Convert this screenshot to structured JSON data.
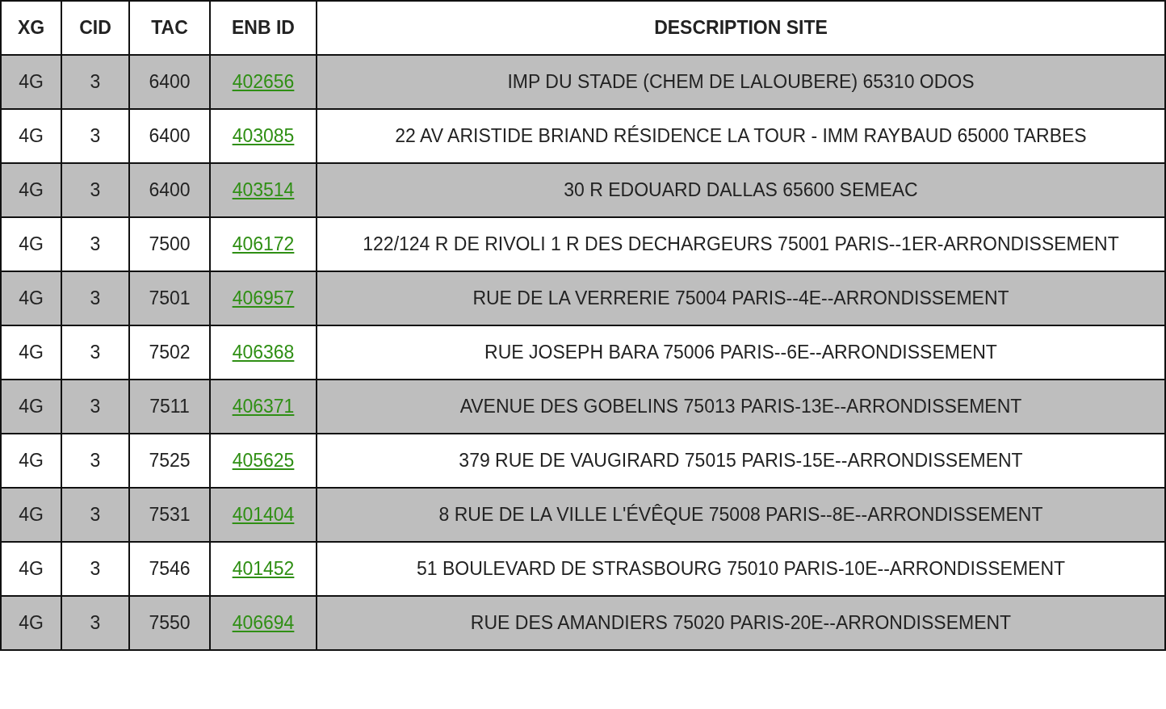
{
  "table": {
    "columns": [
      "XG",
      "CID",
      "TAC",
      "ENB ID",
      "DESCRIPTION SITE"
    ],
    "rows": [
      {
        "xg": "4G",
        "cid": "3",
        "tac": "6400",
        "enb_id": "402656",
        "description": "IMP DU STADE (CHEM DE LALOUBERE) 65310 ODOS"
      },
      {
        "xg": "4G",
        "cid": "3",
        "tac": "6400",
        "enb_id": "403085",
        "description": "22 AV ARISTIDE BRIAND RÉSIDENCE LA TOUR - IMM RAYBAUD 65000 TARBES"
      },
      {
        "xg": "4G",
        "cid": "3",
        "tac": "6400",
        "enb_id": "403514",
        "description": "30 R EDOUARD DALLAS 65600 SEMEAC"
      },
      {
        "xg": "4G",
        "cid": "3",
        "tac": "7500",
        "enb_id": "406172",
        "description": "122/124 R DE RIVOLI 1 R DES DECHARGEURS 75001 PARIS--1ER-ARRONDISSEMENT"
      },
      {
        "xg": "4G",
        "cid": "3",
        "tac": "7501",
        "enb_id": "406957",
        "description": "RUE DE LA VERRERIE 75004 PARIS--4E--ARRONDISSEMENT"
      },
      {
        "xg": "4G",
        "cid": "3",
        "tac": "7502",
        "enb_id": "406368",
        "description": "RUE JOSEPH BARA 75006 PARIS--6E--ARRONDISSEMENT"
      },
      {
        "xg": "4G",
        "cid": "3",
        "tac": "7511",
        "enb_id": "406371",
        "description": "AVENUE DES GOBELINS 75013 PARIS-13E--ARRONDISSEMENT"
      },
      {
        "xg": "4G",
        "cid": "3",
        "tac": "7525",
        "enb_id": "405625",
        "description": "379 RUE DE VAUGIRARD 75015 PARIS-15E--ARRONDISSEMENT"
      },
      {
        "xg": "4G",
        "cid": "3",
        "tac": "7531",
        "enb_id": "401404",
        "description": "8 RUE DE LA VILLE L'ÉVÊQUE 75008 PARIS--8E--ARRONDISSEMENT"
      },
      {
        "xg": "4G",
        "cid": "3",
        "tac": "7546",
        "enb_id": "401452",
        "description": "51 BOULEVARD DE STRASBOURG 75010 PARIS-10E--ARRONDISSEMENT"
      },
      {
        "xg": "4G",
        "cid": "3",
        "tac": "7550",
        "enb_id": "406694",
        "description": "RUE DES AMANDIERS 75020 PARIS-20E--ARRONDISSEMENT"
      }
    ]
  }
}
